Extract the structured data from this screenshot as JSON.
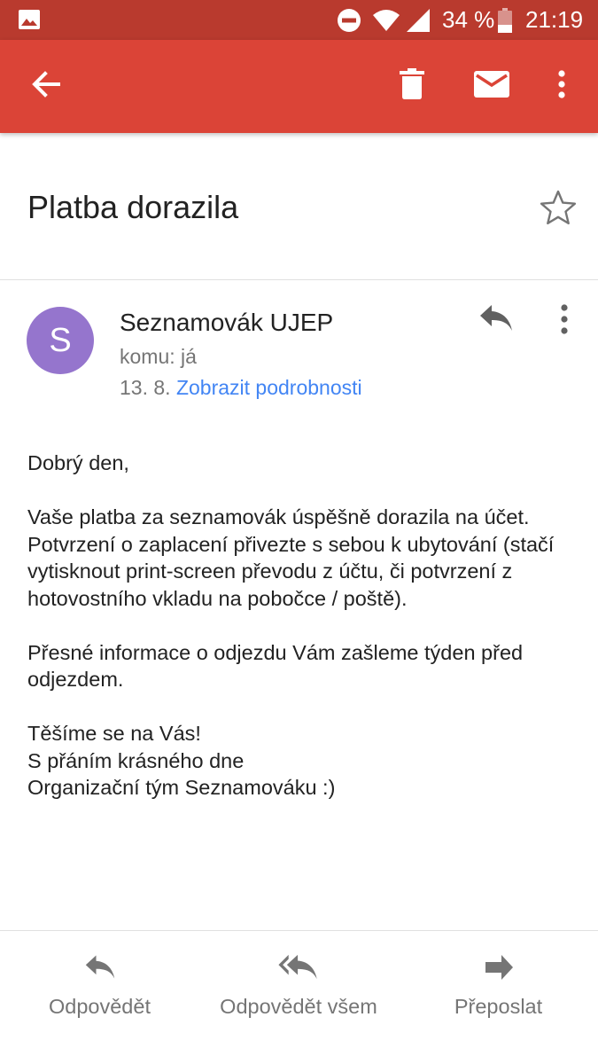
{
  "status_bar": {
    "battery": "34 %",
    "time": "21:19"
  },
  "app_bar": {
    "icons": [
      "back-arrow-icon",
      "delete-icon",
      "mark-unread-icon",
      "more-vert-icon"
    ]
  },
  "email": {
    "subject": "Platba dorazila",
    "sender_initial": "S",
    "sender_name": "Seznamovák UJEP",
    "recipient": "komu: já",
    "date": "13. 8.",
    "details_link": "Zobrazit podrobnosti",
    "avatar_color": "#9575cd",
    "body": {
      "greeting": "Dobrý den,",
      "para1": "Vaše platba za seznamovák úspěšně dorazila na účet. Potvrzení o zaplacení přivezte s sebou k ubytování (stačí vytisknout print-screen převodu z účtu, či potvrzení z hotovostního vkladu na pobočce / poště).",
      "para2": "Přesné informace o odjezdu Vám zašleme týden před odjezdem.",
      "closing1": "Těšíme se na Vás!",
      "closing2": "S přáním krásného dne",
      "closing3": "Organizační tým Seznamováku :)"
    }
  },
  "bottom_actions": {
    "reply": "Odpovědět",
    "reply_all": "Odpovědět všem",
    "forward": "Přeposlat"
  },
  "colors": {
    "status_bar": "#b93a2e",
    "app_bar": "#db4437",
    "link": "#4285f4"
  }
}
